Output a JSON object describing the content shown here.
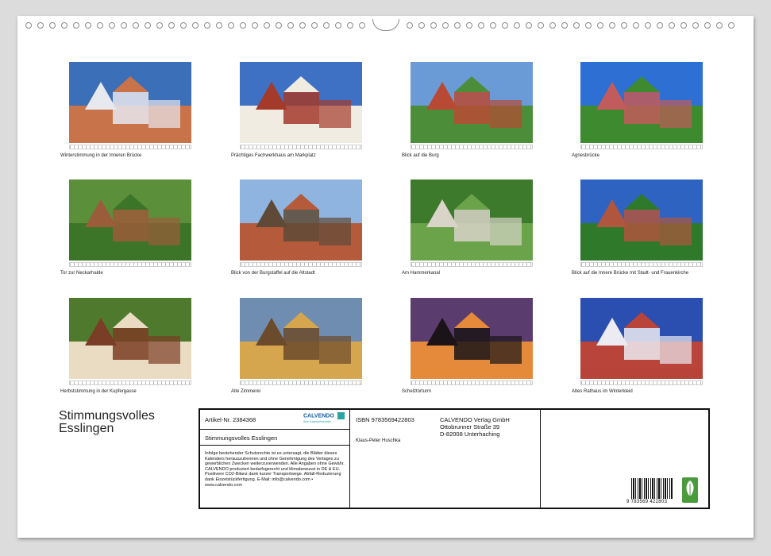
{
  "calendar": {
    "title_line1": "Stimmungsvolles",
    "title_line2": "Esslingen",
    "photos": [
      {
        "caption": "Winterstimmung in der Inneren Brücke",
        "colors": [
          "#3b6fb8",
          "#c9734a",
          "#e8e8ef"
        ]
      },
      {
        "caption": "Prächtiges Fachwerkhaus am Markplatz",
        "colors": [
          "#3e70c4",
          "#f1ece2",
          "#a33a2a"
        ]
      },
      {
        "caption": "Blick auf die Burg",
        "colors": [
          "#6a9bd6",
          "#4c8d3a",
          "#b84a35"
        ]
      },
      {
        "caption": "Agnesbrücke",
        "colors": [
          "#2d6fd2",
          "#3e8a2e",
          "#c25b5b"
        ]
      },
      {
        "caption": "Tor zur Neckarhalde",
        "colors": [
          "#5c8f3a",
          "#3c7428",
          "#9b5c3a"
        ]
      },
      {
        "caption": "Blick von der Burgstaffel auf die Altstadt",
        "colors": [
          "#8fb4e0",
          "#b65a3c",
          "#5e4a36"
        ]
      },
      {
        "caption": "Am Hammerkanal",
        "colors": [
          "#3d7a2c",
          "#6aa34a",
          "#d9d4c8"
        ]
      },
      {
        "caption": "Blick auf die Innere Brücke mit Stadt- und Frauenkirche",
        "colors": [
          "#2f63c2",
          "#2f7a2a",
          "#b0553e"
        ]
      },
      {
        "caption": "Herbststimmung in der Kupfergasse",
        "colors": [
          "#4f7a2e",
          "#e9dcc2",
          "#7a3d25"
        ]
      },
      {
        "caption": "Alte Zimmerei",
        "colors": [
          "#6f8db0",
          "#d6a64f",
          "#6c4a2c"
        ]
      },
      {
        "caption": "Schelztorturm",
        "colors": [
          "#5a3c6e",
          "#e58a3a",
          "#1a1418"
        ]
      },
      {
        "caption": "Altes Rathaus im Winterkleid",
        "colors": [
          "#2a4fb0",
          "#b8443a",
          "#ecebf2"
        ]
      }
    ]
  },
  "info": {
    "article_no": "Artikel-Nr. 2384368",
    "calvendo_logo": "CALVENDO",
    "calvendo_sub": "Ihre Kalendermarke",
    "product_title": "Stimmungsvolles Esslingen",
    "legal_text": "Infolge bestehender Schutzrechte ist es untersagt, die Blätter dieses Kalenders herauszutrennen und ohne Genehmigung des Verlages zu gewerblichen Zwecken weiterzuverwenden. Alle Angaben ohne Gewähr. CALVENDO produziert bedarfsgerecht und klimabewusst in DE & EU. Positivere CO2-Bilanz dank kurzer Transportwege. Abfall-Reduzierung dank Einzelstückfertigung. E-Mail: info@calvendo.com • www.calvendo.com",
    "isbn": "ISBN 9783569422803",
    "author": "Klaus-Peter Huschka",
    "publisher_name": "CALVENDO Verlag GmbH",
    "publisher_street": "Ottobrunner Straße 39",
    "publisher_city": "D-82008 Unterhaching",
    "barcode_number": "9 783569 422803"
  }
}
